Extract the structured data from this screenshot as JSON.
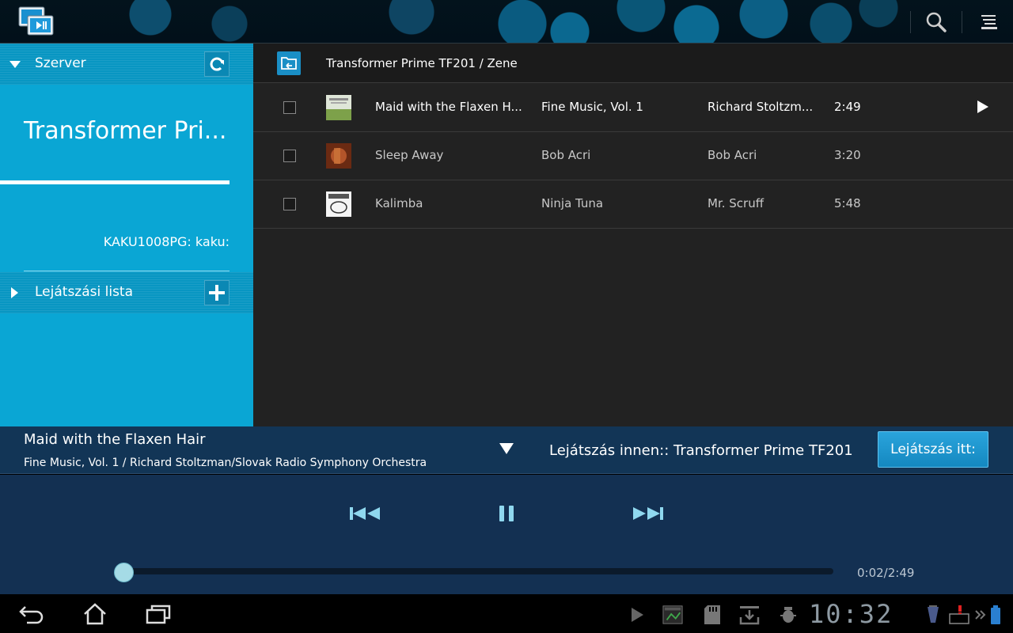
{
  "sidebar": {
    "server_label": "Szerver",
    "device_name": "Transformer Pri...",
    "server_id": "KAKU1008PG: kaku:",
    "playlist_label": "Lejátszási lista"
  },
  "browser": {
    "path": "Transformer Prime TF201 / Zene",
    "tracks": [
      {
        "title": "Maid with the Flaxen H...",
        "album": "Fine Music, Vol. 1",
        "artist": "Richard Stoltzm...",
        "duration": "2:49",
        "playing": true
      },
      {
        "title": "Sleep Away",
        "album": "Bob Acri",
        "artist": "Bob Acri",
        "duration": "3:20",
        "playing": false
      },
      {
        "title": "Kalimba",
        "album": "Ninja Tuna",
        "artist": "Mr. Scruff",
        "duration": "5:48",
        "playing": false
      }
    ]
  },
  "now_playing": {
    "title": "Maid with the Flaxen Hair",
    "subtitle": "Fine Music, Vol. 1 / Richard Stoltzman/Slovak Radio Symphony Orchestra",
    "play_from": "Lejátszás innen:: Transformer Prime TF201",
    "play_here_label": "Lejátszás itt:",
    "time": "0:02/2:49",
    "progress": 0.012
  },
  "system": {
    "clock": "10:32"
  },
  "colors": {
    "accent": "#0aa6d4",
    "player_bg": "#133052",
    "list_bg": "#222222"
  }
}
